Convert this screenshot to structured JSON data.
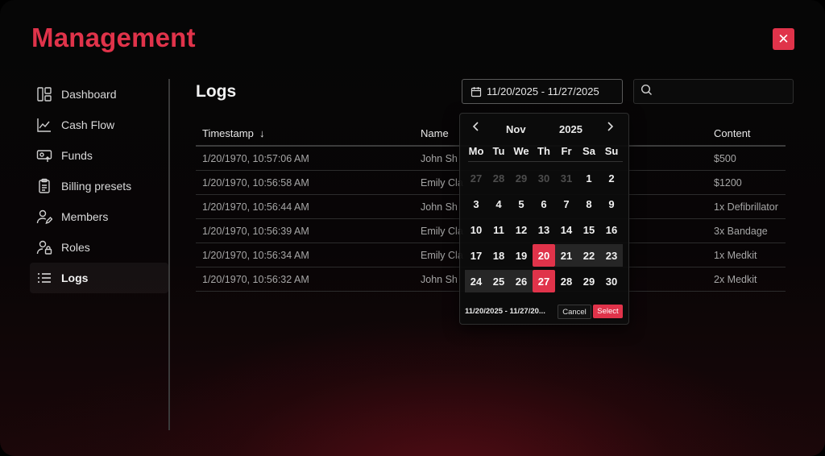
{
  "app": {
    "title": "Management"
  },
  "sidebar": {
    "items": [
      {
        "label": "Dashboard",
        "icon": "dashboard-icon"
      },
      {
        "label": "Cash Flow",
        "icon": "chart-icon"
      },
      {
        "label": "Funds",
        "icon": "funds-icon"
      },
      {
        "label": "Billing presets",
        "icon": "clipboard-icon"
      },
      {
        "label": "Members",
        "icon": "members-icon"
      },
      {
        "label": "Roles",
        "icon": "roles-icon"
      },
      {
        "label": "Logs",
        "icon": "list-icon",
        "active": true
      }
    ]
  },
  "main": {
    "title": "Logs",
    "date_range": "11/20/2025 - 11/27/2025",
    "search": {
      "value": "",
      "placeholder": ""
    },
    "table": {
      "columns": [
        "Timestamp",
        "Name",
        "Content"
      ],
      "sort_indicator": "↓",
      "rows": [
        {
          "timestamp": "1/20/1970, 10:57:06 AM",
          "name": "John Sh",
          "content": "$500"
        },
        {
          "timestamp": "1/20/1970, 10:56:58 AM",
          "name": "Emily Cla",
          "content": "$1200"
        },
        {
          "timestamp": "1/20/1970, 10:56:44 AM",
          "name": "John Sh",
          "content": "1x Defibrillator"
        },
        {
          "timestamp": "1/20/1970, 10:56:39 AM",
          "name": "Emily Cla",
          "content": "3x Bandage"
        },
        {
          "timestamp": "1/20/1970, 10:56:34 AM",
          "name": "Emily Cla",
          "content": "1x Medkit"
        },
        {
          "timestamp": "1/20/1970, 10:56:32 AM",
          "name": "John Sh",
          "content": "2x Medkit"
        }
      ]
    }
  },
  "calendar": {
    "month": "Nov",
    "year": "2025",
    "weekdays": [
      "Mo",
      "Tu",
      "We",
      "Th",
      "Fr",
      "Sa",
      "Su"
    ],
    "weeks": [
      [
        "27",
        "28",
        "29",
        "30",
        "31",
        "1",
        "2"
      ],
      [
        "3",
        "4",
        "5",
        "6",
        "7",
        "8",
        "9"
      ],
      [
        "10",
        "11",
        "12",
        "13",
        "14",
        "15",
        "16"
      ],
      [
        "17",
        "18",
        "19",
        "20",
        "21",
        "22",
        "23"
      ],
      [
        "24",
        "25",
        "26",
        "27",
        "28",
        "29",
        "30"
      ]
    ],
    "muted": [
      [
        0,
        0
      ],
      [
        0,
        1
      ],
      [
        0,
        2
      ],
      [
        0,
        3
      ],
      [
        0,
        4
      ]
    ],
    "selected": [
      [
        3,
        3
      ],
      [
        4,
        3
      ]
    ],
    "in_range": [
      [
        3,
        4
      ],
      [
        3,
        5
      ],
      [
        3,
        6
      ],
      [
        4,
        0
      ],
      [
        4,
        1
      ],
      [
        4,
        2
      ]
    ],
    "footer_text": "11/20/2025 - 11/27/20...",
    "cancel_label": "Cancel",
    "select_label": "Select"
  },
  "colors": {
    "accent": "#e0334a",
    "background": "#060606"
  }
}
